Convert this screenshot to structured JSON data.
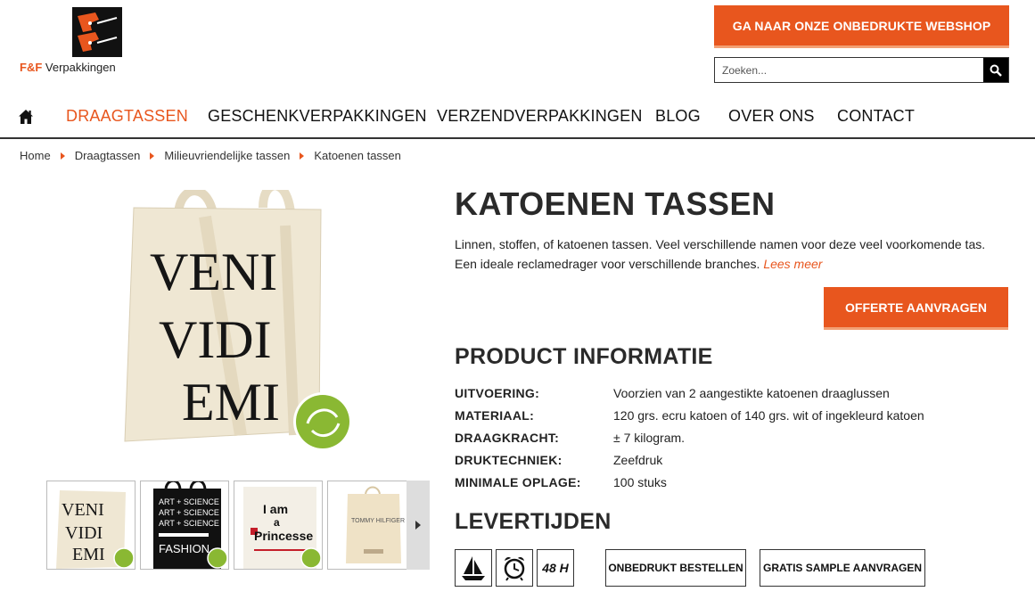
{
  "header": {
    "logo_brand": "F&F",
    "logo_name": "Verpakkingen",
    "webshop_button": "GA NAAR ONZE ONBEDRUKTE WEBSHOP",
    "search_placeholder": "Zoeken...",
    "accent_color": "#e8561e"
  },
  "nav": {
    "home_icon": "home-icon",
    "items": [
      "DRAAGTASSEN",
      "GESCHENKVERPAKKINGEN",
      "VERZENDVERPAKKINGEN",
      "BLOG",
      "OVER ONS",
      "CONTACT"
    ],
    "active": "DRAAGTASSEN"
  },
  "breadcrumb": [
    "Home",
    "Draagtassen",
    "Milieuvriendelijke tassen",
    "Katoenen tassen"
  ],
  "product": {
    "main_image_text": [
      "VENI",
      "VIDI",
      "EMI"
    ],
    "thumbnails": [
      {
        "lines": [
          "VENI",
          "VIDI",
          "EMI"
        ]
      },
      {
        "lines": [
          "ART + SCIENCE",
          "ART + SCIENCE",
          "ART + SCIENCE",
          "FASHION"
        ]
      },
      {
        "lines": [
          "I am",
          "a",
          "Princesse"
        ]
      },
      {
        "lines": [
          "TOMMY HILFIGER"
        ]
      }
    ],
    "title": "KATOENEN TASSEN",
    "description": "Linnen, stoffen, of katoenen tassen. Veel verschillende namen voor deze veel voorkomende tas. Een ideale reclamedrager voor verschillende branches.",
    "read_more": "Lees meer",
    "offerte_button": "OFFERTE AANVRAGEN"
  },
  "info": {
    "heading": "PRODUCT INFORMATIE",
    "rows": [
      {
        "label": "UITVOERING:",
        "value": "Voorzien van 2 aangestikte katoenen draaglussen"
      },
      {
        "label": "MATERIAAL:",
        "value": "120 grs. ecru katoen of 140 grs. wit of ingekleurd katoen"
      },
      {
        "label": "DRAAGKRACHT:",
        "value": "± 7 kilogram."
      },
      {
        "label": "DRUKTECHNIEK:",
        "value": "Zeefdruk"
      },
      {
        "label": "MINIMALE OPLAGE:",
        "value": "100 stuks"
      }
    ]
  },
  "levertijden": {
    "heading": "LEVERTIJDEN",
    "icons": [
      "ship-icon",
      "alarm-clock-icon",
      "48h-icon"
    ],
    "fast_label": "48 H",
    "buttons": [
      "ONBEDRUKT BESTELLEN",
      "GRATIS SAMPLE AANVRAGEN"
    ]
  }
}
